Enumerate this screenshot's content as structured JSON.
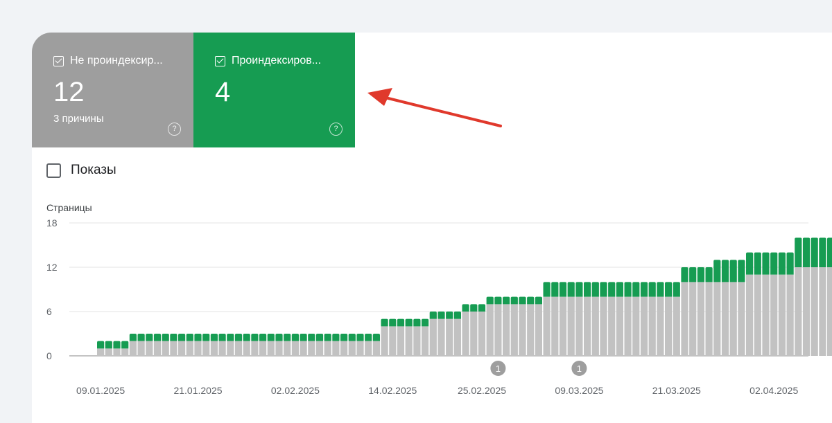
{
  "tiles": {
    "not_indexed": {
      "label": "Не проиндексир...",
      "count": "12",
      "note": "3 причины",
      "help_icon": "?"
    },
    "indexed": {
      "label": "Проиндексиров...",
      "count": "4",
      "help_icon": "?"
    }
  },
  "legend": {
    "impressions_label": "Показы"
  },
  "colors": {
    "not_indexed": "#9e9e9e",
    "not_indexed_bar": "#c2c2c2",
    "indexed": "#169c52",
    "annotation_arrow": "#e0392c"
  },
  "chart_data": {
    "type": "bar",
    "stacked": true,
    "ylabel": "Страницы",
    "ylim": [
      0,
      18
    ],
    "yticks": [
      "18",
      "12",
      "6",
      "0"
    ],
    "ytick_values": [
      18,
      12,
      6,
      0
    ],
    "xtick_labels": [
      "09.01.2025",
      "21.01.2025",
      "02.02.2025",
      "14.02.2025",
      "25.02.2025",
      "09.03.2025",
      "21.03.2025",
      "02.04.2025"
    ],
    "xtick_index": [
      0,
      12,
      24,
      36,
      47,
      59,
      71,
      83
    ],
    "start_date": "2025-01-09",
    "series": [
      {
        "name": "Не проиндексир...",
        "values": [
          1,
          1,
          1,
          1,
          2,
          2,
          2,
          2,
          2,
          2,
          2,
          2,
          2,
          2,
          2,
          2,
          2,
          2,
          2,
          2,
          2,
          2,
          2,
          2,
          2,
          2,
          2,
          2,
          2,
          2,
          2,
          2,
          2,
          2,
          2,
          4,
          4,
          4,
          4,
          4,
          4,
          5,
          5,
          5,
          5,
          6,
          6,
          6,
          7,
          7,
          7,
          7,
          7,
          7,
          7,
          8,
          8,
          8,
          8,
          8,
          8,
          8,
          8,
          8,
          8,
          8,
          8,
          8,
          8,
          8,
          8,
          8,
          10,
          10,
          10,
          10,
          10,
          10,
          10,
          10,
          11,
          11,
          11,
          11,
          11,
          11,
          12,
          12,
          12,
          12,
          12,
          12,
          12
        ]
      },
      {
        "name": "Проиндексиров...",
        "values": [
          1,
          1,
          1,
          1,
          1,
          1,
          1,
          1,
          1,
          1,
          1,
          1,
          1,
          1,
          1,
          1,
          1,
          1,
          1,
          1,
          1,
          1,
          1,
          1,
          1,
          1,
          1,
          1,
          1,
          1,
          1,
          1,
          1,
          1,
          1,
          1,
          1,
          1,
          1,
          1,
          1,
          1,
          1,
          1,
          1,
          1,
          1,
          1,
          1,
          1,
          1,
          1,
          1,
          1,
          1,
          2,
          2,
          2,
          2,
          2,
          2,
          2,
          2,
          2,
          2,
          2,
          2,
          2,
          2,
          2,
          2,
          2,
          2,
          2,
          2,
          2,
          3,
          3,
          3,
          3,
          3,
          3,
          3,
          3,
          3,
          3,
          4,
          4,
          4,
          4,
          4,
          4,
          4
        ]
      }
    ],
    "annotations": [
      {
        "label": "1",
        "date": "2025-02-27"
      },
      {
        "label": "1",
        "date": "2025-03-09"
      }
    ]
  }
}
